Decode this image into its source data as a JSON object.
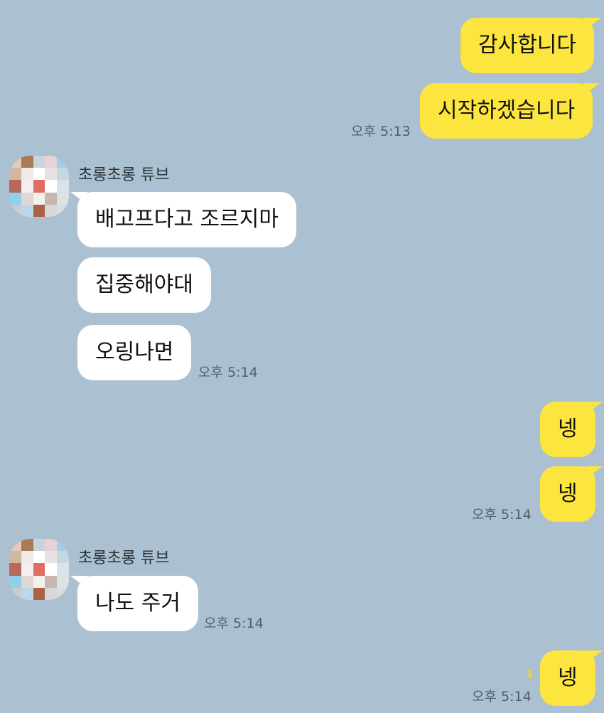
{
  "messages": [
    {
      "from": "me",
      "text": "감사합니다"
    },
    {
      "from": "me",
      "text": "시작하겠습니다",
      "time": "오후 5:13"
    },
    {
      "from": "other",
      "sender": "초롱초롱 튜브",
      "text": "배고프다고 조르지마"
    },
    {
      "from": "other",
      "text": "집중해야대"
    },
    {
      "from": "other",
      "text": "오링나면",
      "time": "오후 5:14"
    },
    {
      "from": "me",
      "text": "넹"
    },
    {
      "from": "me",
      "text": "넹",
      "time": "오후 5:14"
    },
    {
      "from": "other",
      "sender": "초롱초롱 튜브",
      "text": "나도 주거",
      "time": "오후 5:14"
    },
    {
      "from": "me",
      "text": "넹",
      "unread": "1",
      "time": "오후 5:14"
    }
  ],
  "colors": {
    "background": "#abc1d1",
    "my_bubble": "#fde53f",
    "other_bubble": "#ffffff",
    "unread": "#f2d43a"
  },
  "avatar_pixels": [
    "#e6c9b8",
    "#a87a55",
    "#c9d3dc",
    "#e8d2d8",
    "#9fd0e6",
    "#d2b6a4",
    "#f1e9e6",
    "#ffffff",
    "#eae0e0",
    "#c7d6df",
    "#b7695a",
    "#f2f0ef",
    "#e06d62",
    "#ffffff",
    "#d8e3ea",
    "#8fd0ea",
    "#e0d7d5",
    "#f4f0ee",
    "#c8b7ad",
    "#dde2e5",
    "#c9ccd1",
    "#b7d9e8",
    "#a96242",
    "#d6d9dc",
    "#d8dde2"
  ]
}
